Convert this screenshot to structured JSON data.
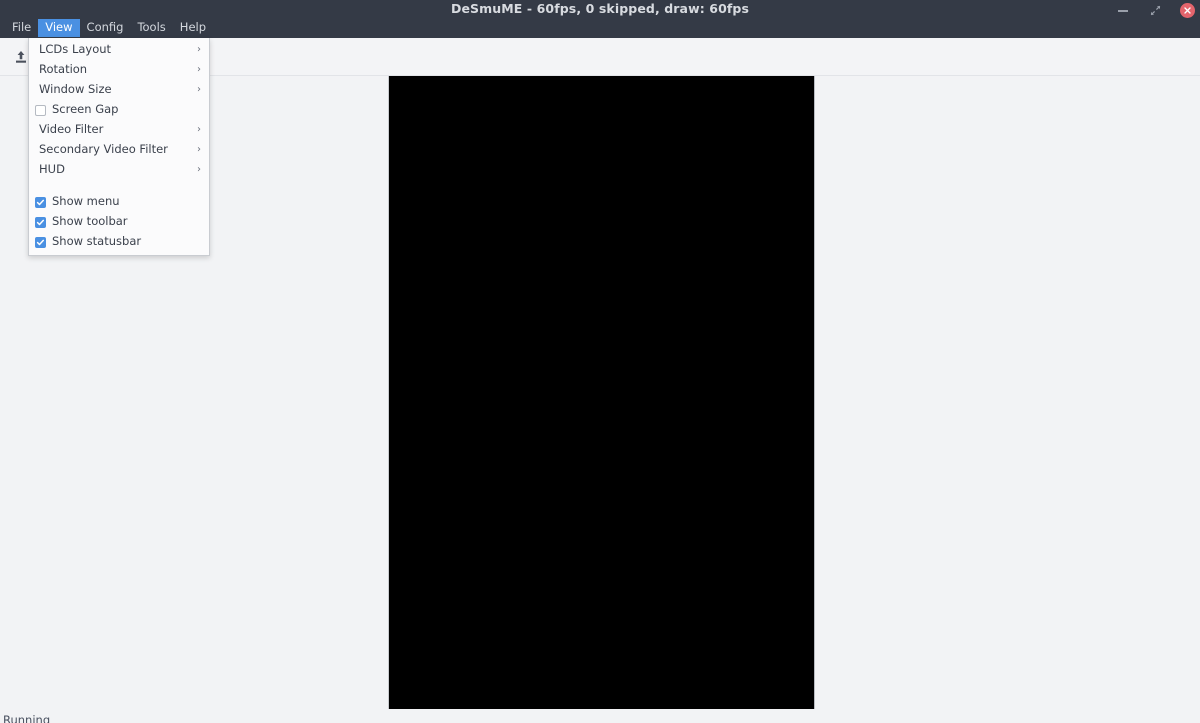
{
  "window": {
    "title": "DeSmuME - 60fps, 0 skipped, draw: 60fps",
    "controls": {
      "minimize": "minimize",
      "maximize": "maximize",
      "close": "close"
    },
    "accent_color": "#4a90e2",
    "titlebar_color": "#343a46",
    "close_button_color": "#e4646c",
    "background_color": "#f2f3f5"
  },
  "menubar": {
    "items": [
      {
        "label": "File",
        "active": false
      },
      {
        "label": "View",
        "active": true
      },
      {
        "label": "Config",
        "active": false
      },
      {
        "label": "Tools",
        "active": false
      },
      {
        "label": "Help",
        "active": false
      }
    ]
  },
  "toolbar": {
    "buttons": [
      {
        "icon": "open-rom-icon",
        "label": "Open ROM"
      }
    ]
  },
  "view_menu": {
    "items": [
      {
        "label": "LCDs Layout",
        "type": "submenu"
      },
      {
        "label": "Rotation",
        "type": "submenu"
      },
      {
        "label": "Window Size",
        "type": "submenu"
      },
      {
        "label": "Screen Gap",
        "type": "checkbox",
        "checked": false
      },
      {
        "label": "Video Filter",
        "type": "submenu"
      },
      {
        "label": "Secondary Video Filter",
        "type": "submenu"
      },
      {
        "label": "HUD",
        "type": "submenu"
      },
      {
        "label": "Show menu",
        "type": "checkbox",
        "checked": true
      },
      {
        "label": "Show toolbar",
        "type": "checkbox",
        "checked": true
      },
      {
        "label": "Show statusbar",
        "type": "checkbox",
        "checked": true
      }
    ],
    "submenu_arrow": "›"
  },
  "viewport": {
    "screen_color": "#000000"
  },
  "statusbar": {
    "text": "Running"
  }
}
